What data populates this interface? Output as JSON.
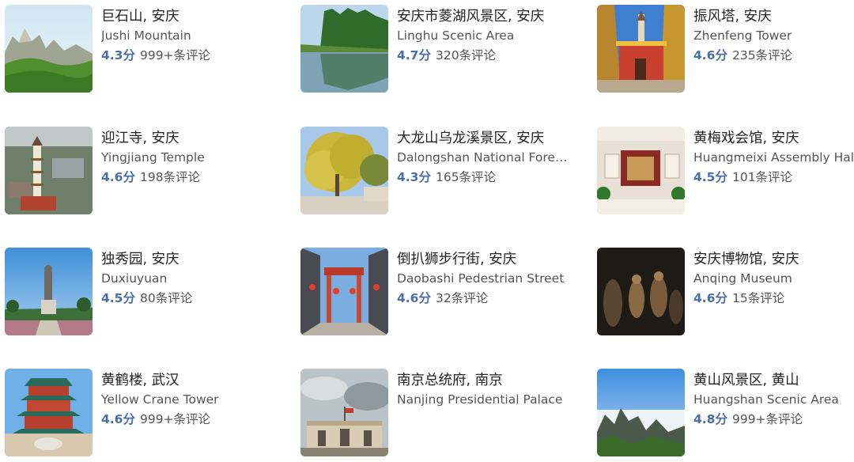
{
  "accent_color": "#4a6fa5",
  "cards": [
    {
      "title": "巨石山, 安庆",
      "subtitle": "Jushi Mountain",
      "score": "4.3分",
      "reviews": "999+条评论"
    },
    {
      "title": "安庆市菱湖风景区, 安庆",
      "subtitle": "Linghu Scenic Area",
      "score": "4.7分",
      "reviews": "320条评论"
    },
    {
      "title": "振风塔, 安庆",
      "subtitle": "Zhenfeng Tower",
      "score": "4.6分",
      "reviews": "235条评论"
    },
    {
      "title": "迎江寺, 安庆",
      "subtitle": "Yingjiang Temple",
      "score": "4.6分",
      "reviews": "198条评论"
    },
    {
      "title": "大龙山乌龙溪景区, 安庆",
      "subtitle": "Dalongshan National Forest...",
      "score": "4.3分",
      "reviews": "165条评论"
    },
    {
      "title": "黄梅戏会馆, 安庆",
      "subtitle": "Huangmeixi Assembly Hall",
      "score": "4.5分",
      "reviews": "101条评论"
    },
    {
      "title": "独秀园, 安庆",
      "subtitle": "Duxiuyuan",
      "score": "4.5分",
      "reviews": "80条评论"
    },
    {
      "title": "倒扒狮步行街, 安庆",
      "subtitle": "Daobashi Pedestrian Street",
      "score": "4.6分",
      "reviews": "32条评论"
    },
    {
      "title": "安庆博物馆, 安庆",
      "subtitle": "Anqing Museum",
      "score": "4.6分",
      "reviews": "15条评论"
    },
    {
      "title": "黄鹤楼, 武汉",
      "subtitle": "Yellow Crane Tower",
      "score": "4.6分",
      "reviews": "999+条评论"
    },
    {
      "title": "南京总统府, 南京",
      "subtitle": "Nanjing Presidential Palace",
      "score": "",
      "reviews": ""
    },
    {
      "title": "黄山风景区, 黄山",
      "subtitle": "Huangshan Scenic Area",
      "score": "4.8分",
      "reviews": "999+条评论"
    }
  ]
}
